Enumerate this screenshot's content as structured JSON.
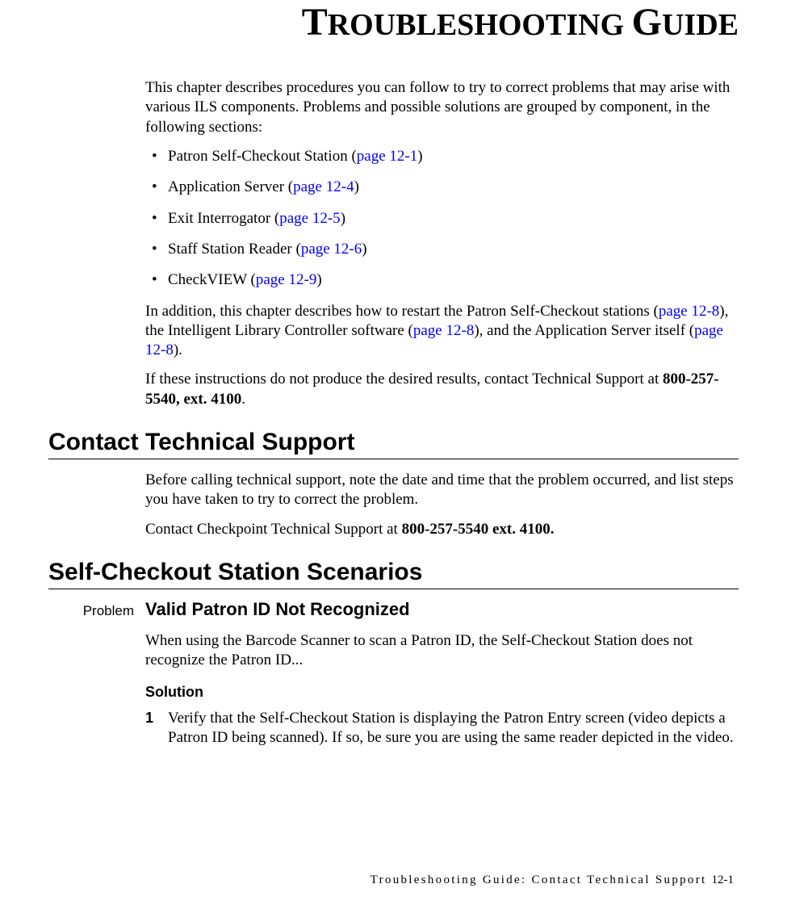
{
  "chapter": {
    "title_part1": "T",
    "title_part2": "ROUBLESHOOTING",
    "title_part3": "G",
    "title_part4": "UIDE"
  },
  "intro": {
    "p1": "This chapter describes procedures you can follow to try to correct problems that may arise with various ILS components. Problems and possible solutions are grouped by component, in the following sections:",
    "bullets": [
      {
        "text": "Patron Self-Checkout Station (",
        "link": "page 12-1",
        "suffix": ")"
      },
      {
        "text": "Application Server (",
        "link": "page 12-4",
        "suffix": ")"
      },
      {
        "text": "Exit Interrogator (",
        "link": "page 12-5",
        "suffix": ")"
      },
      {
        "text": "Staff Station Reader (",
        "link": "page 12-6",
        "suffix": ")"
      },
      {
        "text": "CheckVIEW (",
        "link": "page 12-9",
        "suffix": ")"
      }
    ],
    "p2_a": "In addition, this chapter describes how to restart the Patron Self-Checkout stations (",
    "p2_link1": "page 12-8",
    "p2_b": "), the Intelligent Library Controller software (",
    "p2_link2": "page 12-8",
    "p2_c": "), and the Application Server itself (",
    "p2_link3": "page 12-8",
    "p2_d": ").",
    "p3_a": "If these instructions do not produce the desired results, contact Technical Support at ",
    "p3_bold": "800-257-5540, ext. 4100",
    "p3_b": "."
  },
  "section1": {
    "heading": "Contact Technical Support",
    "p1": "Before calling technical support, note the date and time that the problem occurred, and list steps you have taken to try to correct the problem.",
    "p2_a": "Contact Checkpoint Technical Support at ",
    "p2_bold": "800-257-5540 ext. 4100."
  },
  "section2": {
    "heading": "Self-Checkout Station Scenarios",
    "problem_label": "Problem",
    "problem_title": "Valid Patron ID Not Recognized",
    "problem_desc": "When using the Barcode Scanner to scan a Patron ID, the Self-Checkout Station does not recognize the Patron ID...",
    "solution_heading": "Solution",
    "step1_num": "1",
    "step1_text": "Verify that the Self-Checkout Station is displaying the Patron Entry screen (video depicts a Patron ID being scanned). If so, be sure you are using the same reader depicted in the video."
  },
  "footer": {
    "text": "Troubleshooting Guide: Contact Technical Support",
    "page": "12-1"
  }
}
